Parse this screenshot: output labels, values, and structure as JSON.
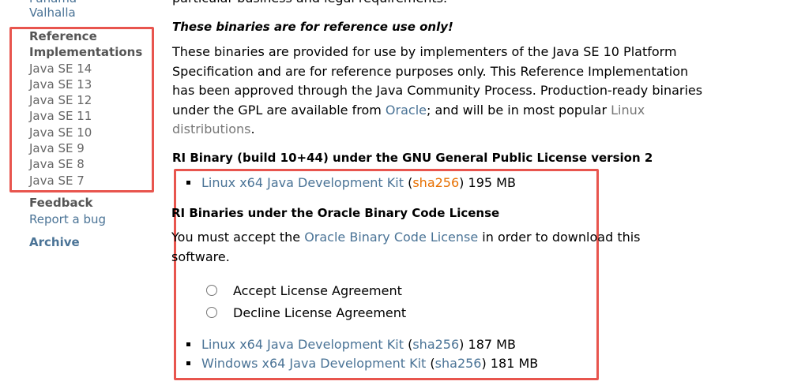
{
  "sidebar": {
    "partial_top": "Panama",
    "valhalla": "Valhalla",
    "ref_heading_1": "Reference",
    "ref_heading_2": "Implementations",
    "ref_items": [
      "Java SE 14",
      "Java SE 13",
      "Java SE 12",
      "Java SE 11",
      "Java SE 10",
      "Java SE 9",
      "Java SE 8",
      "Java SE 7"
    ],
    "feedback": "Feedback",
    "report_bug": "Report a bug",
    "archive": "Archive"
  },
  "main": {
    "partial_top": "particular business and legal requirements.",
    "warning": "These binaries are for reference use only!",
    "para_lines": [
      "These binaries are provided for use by implementers of the Java SE 10 Platform",
      "Specification and are for reference purposes only. This Reference Implementation",
      "has been approved through the Java Community Process. Production-ready binaries"
    ],
    "para_line4_pre": "under the GPL are available from ",
    "oracle_link": "Oracle",
    "para_line4_mid": "; and will be in most popular ",
    "linux_link_1": "Linux",
    "linux_link_2": "distributions",
    "para_end": ".",
    "gpl_heading": "RI Binary (build 10+44) under the GNU General Public License version 2",
    "gpl_download": {
      "label": "Linux x64 Java Development Kit",
      "sha": "sha256",
      "size": "195 MB"
    },
    "bcl_heading": "RI Binaries under the Oracle Binary Code License",
    "accept_pre": "You must accept the ",
    "bcl_link": "Oracle Binary Code License",
    "accept_post": " in order to download this",
    "accept_post2": "software.",
    "radio_accept": "Accept License Agreement",
    "radio_decline": "Decline License Agreement",
    "bcl_downloads": [
      {
        "label": "Linux x64 Java Development Kit",
        "sha": "sha256",
        "size": "187 MB"
      },
      {
        "label": "Windows x64 Java Development Kit",
        "sha": "sha256",
        "size": "181 MB"
      }
    ],
    "punct_open": "(",
    "punct_close": ")"
  },
  "colors": {
    "link": "#4a7396",
    "visited": "#e76f00",
    "highlight": "#e8554e"
  }
}
